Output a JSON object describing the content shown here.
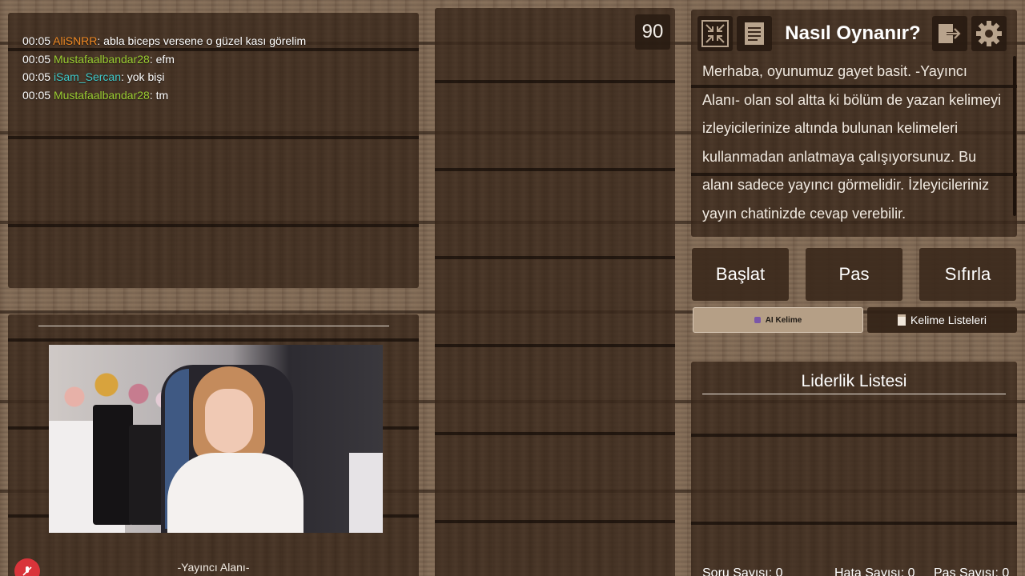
{
  "chat": {
    "messages": [
      {
        "time": "00:05",
        "user": "AliSNRR",
        "user_color": "#f08a24",
        "text": ": abla biceps versene o güzel kası görelim"
      },
      {
        "time": "00:05",
        "user": "Mustafaalbandar28",
        "user_color": "#9acd32",
        "text": ": efm"
      },
      {
        "time": "00:05",
        "user": "iSam_Sercan",
        "user_color": "#3fc9c9",
        "text": ": yok bişi"
      },
      {
        "time": "00:05",
        "user": "Mustafaalbandar28",
        "user_color": "#9acd32",
        "text": ": tm"
      }
    ]
  },
  "streamer": {
    "label": "-Yayıncı Alanı-"
  },
  "timer": {
    "value": "90"
  },
  "howto": {
    "title": "Nasıl Oynanır?",
    "body": "Merhaba, oyunumuz gayet basit. -Yayıncı Alanı- olan sol altta ki bölüm de yazan kelimeyi izleyicilerinize altında bulunan kelimeleri kullanmadan anlatmaya çalışıyorsunuz. Bu alanı sadece yayıncı görmelidir. İzleyicileriniz yayın chatinizde cevap verebilir."
  },
  "actions": {
    "start": "Başlat",
    "pass": "Pas",
    "reset": "Sıfırla"
  },
  "tabs": {
    "ai_word": "AI Kelime",
    "word_lists": "Kelime Listeleri"
  },
  "leaderboard": {
    "title": "Liderlik Listesi",
    "question_count": "Soru Sayısı: 0",
    "error_count": "Hata Sayısı: 0",
    "pass_count": "Pas Sayısı: 0"
  },
  "icons": {
    "collapse": "collapse-icon",
    "document": "document-icon",
    "exit": "exit-icon",
    "settings": "gear-icon",
    "mic_muted": "mic-muted-icon"
  },
  "colors": {
    "panel": "#3a281b",
    "active_tab": "#b59f86",
    "mic_badge": "#d9343a"
  }
}
